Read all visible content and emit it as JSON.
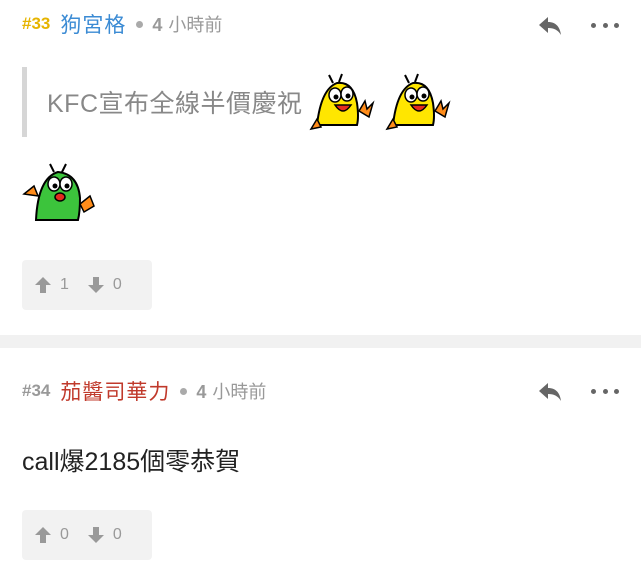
{
  "posts": [
    {
      "number": "#33",
      "username": "狗宮格",
      "time_num": "4",
      "time_unit": "小時前",
      "quote": "KFC宣布全線半價慶祝",
      "upvotes": "1",
      "downvotes": "0",
      "number_color": "#e6b400",
      "username_color": "#3b8bd4"
    },
    {
      "number": "#34",
      "username": "茄醬司華力",
      "time_num": "4",
      "time_unit": "小時前",
      "body": "call爆2185個零恭賀",
      "upvotes": "0",
      "downvotes": "0",
      "number_color": "#999999",
      "username_color": "#c0392b"
    }
  ],
  "icons": {
    "reply": "reply-icon",
    "more": "more-icon",
    "upvote": "thumb-up-arrow-icon",
    "downvote": "thumb-down-arrow-icon",
    "emoji_yellow": "yellow-bug-emoji-icon",
    "emoji_green": "green-bug-emoji-icon"
  }
}
